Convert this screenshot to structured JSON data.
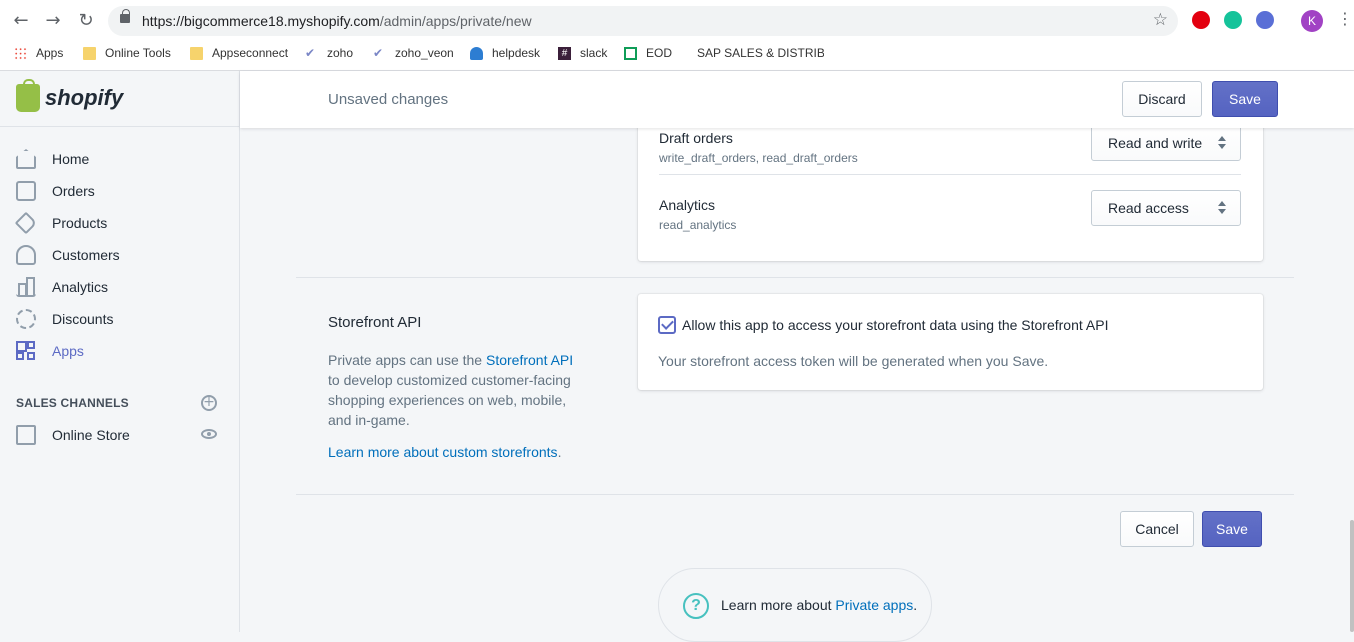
{
  "browser": {
    "url_host": "https://bigcommerce18.myshopify.com",
    "url_path": "/admin/apps/private/new",
    "avatar_initial": "K",
    "bookmarks": [
      "Apps",
      "Online Tools",
      "Appseconnect",
      "zoho",
      "zoho_veon",
      "helpdesk",
      "slack",
      "EOD",
      "SAP SALES & DISTRIB"
    ]
  },
  "brand": {
    "name": "shopify",
    "color": "#95bf47"
  },
  "sidebar": {
    "items": [
      {
        "label": "Home",
        "icon": "home-icon"
      },
      {
        "label": "Orders",
        "icon": "orders-icon"
      },
      {
        "label": "Products",
        "icon": "tag-icon"
      },
      {
        "label": "Customers",
        "icon": "person-icon"
      },
      {
        "label": "Analytics",
        "icon": "bar-chart-icon"
      },
      {
        "label": "Discounts",
        "icon": "discount-icon"
      },
      {
        "label": "Apps",
        "icon": "apps-icon",
        "active": true
      }
    ],
    "channels_label": "SALES CHANNELS",
    "channels": [
      {
        "label": "Online Store",
        "icon": "store-icon"
      }
    ]
  },
  "topbar": {
    "title": "Unsaved changes",
    "discard_label": "Discard",
    "save_label": "Save"
  },
  "permissions": [
    {
      "name": "Draft orders",
      "scope": "write_draft_orders, read_draft_orders",
      "access": "Read and write"
    },
    {
      "name": "Analytics",
      "scope": "read_analytics",
      "access": "Read access"
    }
  ],
  "storefront": {
    "title": "Storefront API",
    "desc_pre": "Private apps can use the ",
    "desc_link": "Storefront API",
    "desc_post": " to develop customized customer-facing shopping experiences on web, mobile, and in-game.",
    "learn_link": "Learn more about custom storefronts",
    "learn_dot": ".",
    "checkbox_label": "Allow this app to access your storefront data using the Storefront API",
    "checked": true,
    "token_note": "Your storefront access token will be generated when you Save."
  },
  "footer": {
    "cancel_label": "Cancel",
    "save_label": "Save",
    "help_pre": "Learn more about ",
    "help_link": "Private apps",
    "help_post": "."
  },
  "colors": {
    "accent": "#5c6ac4",
    "link": "#006fbb",
    "help": "#47c1bf"
  }
}
